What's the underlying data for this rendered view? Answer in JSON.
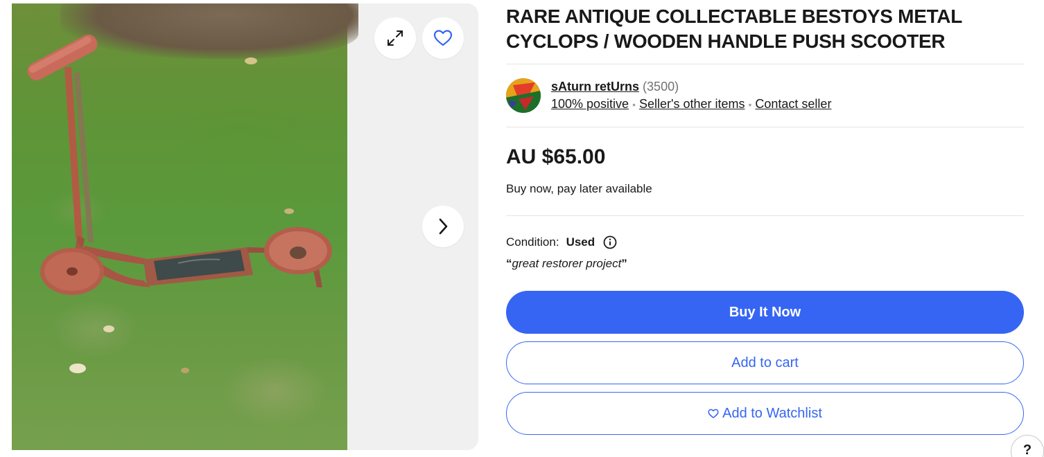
{
  "listing": {
    "title": "RARE ANTIQUE COLLECTABLE BESTOYS METAL CYCLOPS / WOODEN HANDLE PUSH SCOOTER"
  },
  "gallery": {
    "icons": {
      "expand": "expand-icon",
      "favorite": "heart-icon",
      "next": "chevron-right-icon"
    }
  },
  "seller": {
    "name": "sAturn retUrns",
    "feedback_count": "(3500)",
    "positive": "100% positive",
    "other_items": "Seller's other items",
    "contact": "Contact seller"
  },
  "price": {
    "amount": "AU $65.00",
    "bnpl": "Buy now, pay later available"
  },
  "condition": {
    "label": "Condition:",
    "value": "Used",
    "open_quote": "“",
    "note": "great restorer project",
    "close_quote": "”"
  },
  "actions": {
    "buy_now": "Buy It Now",
    "add_to_cart": "Add to cart",
    "watchlist": "Add to Watchlist"
  },
  "help": {
    "label": "?"
  },
  "colors": {
    "accent": "#3665f3",
    "text": "#191919",
    "muted": "#707070",
    "divider": "#e5e5e5"
  }
}
